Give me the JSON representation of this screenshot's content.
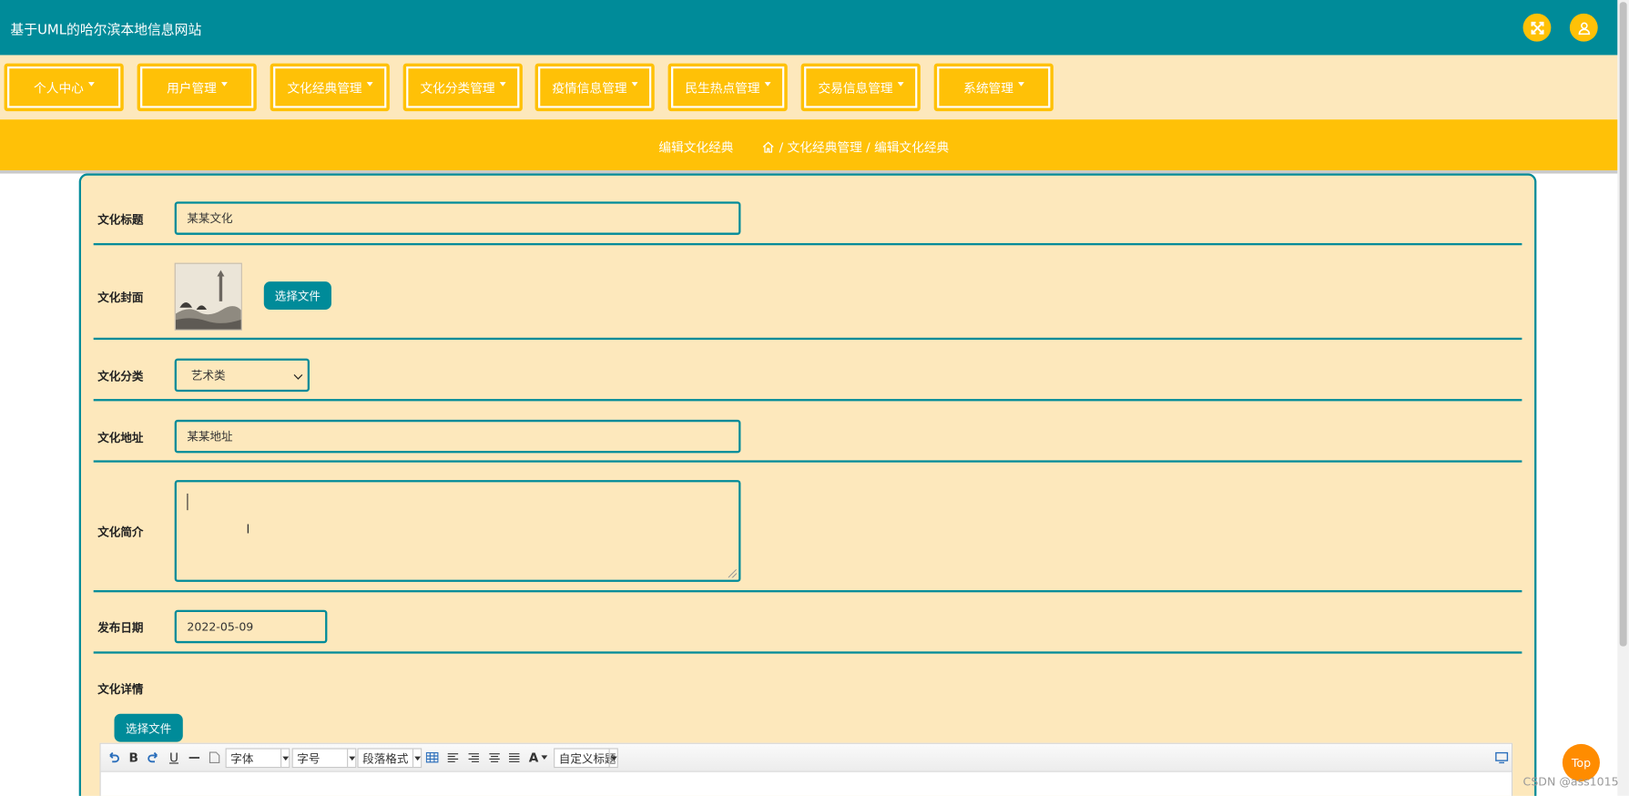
{
  "header": {
    "site_title": "基于UML的哈尔滨本地信息网站",
    "fullscreen_icon": "expand-icon",
    "user_icon": "user-icon",
    "accent_color": "#008b99"
  },
  "nav": {
    "items": [
      {
        "label": "个人中心"
      },
      {
        "label": "用户管理"
      },
      {
        "label": "文化经典管理"
      },
      {
        "label": "文化分类管理"
      },
      {
        "label": "疫情信息管理"
      },
      {
        "label": "民生热点管理"
      },
      {
        "label": "交易信息管理"
      },
      {
        "label": "系统管理"
      }
    ],
    "color": "#ffc107"
  },
  "breadcrumb": {
    "page_title": "编辑文化经典",
    "path": "/ 文化经典管理 / 编辑文化经典"
  },
  "form": {
    "title": {
      "label": "文化标题",
      "value": "某某文化"
    },
    "cover": {
      "label": "文化封面",
      "button": "选择文件"
    },
    "category": {
      "label": "文化分类",
      "value": "艺术类"
    },
    "address": {
      "label": "文化地址",
      "value": "某某地址"
    },
    "intro": {
      "label": "文化简介",
      "value": ""
    },
    "date": {
      "label": "发布日期",
      "value": "2022-05-09"
    },
    "detail": {
      "label": "文化详情",
      "button": "选择文件"
    }
  },
  "editor": {
    "font_family": "字体",
    "font_size": "字号",
    "paragraph": "段落格式",
    "custom_title": "自定义标题",
    "bold": "B",
    "underline": "U",
    "font_color": "A"
  },
  "top_button": "Top",
  "watermark": "CSDN @ass1015"
}
